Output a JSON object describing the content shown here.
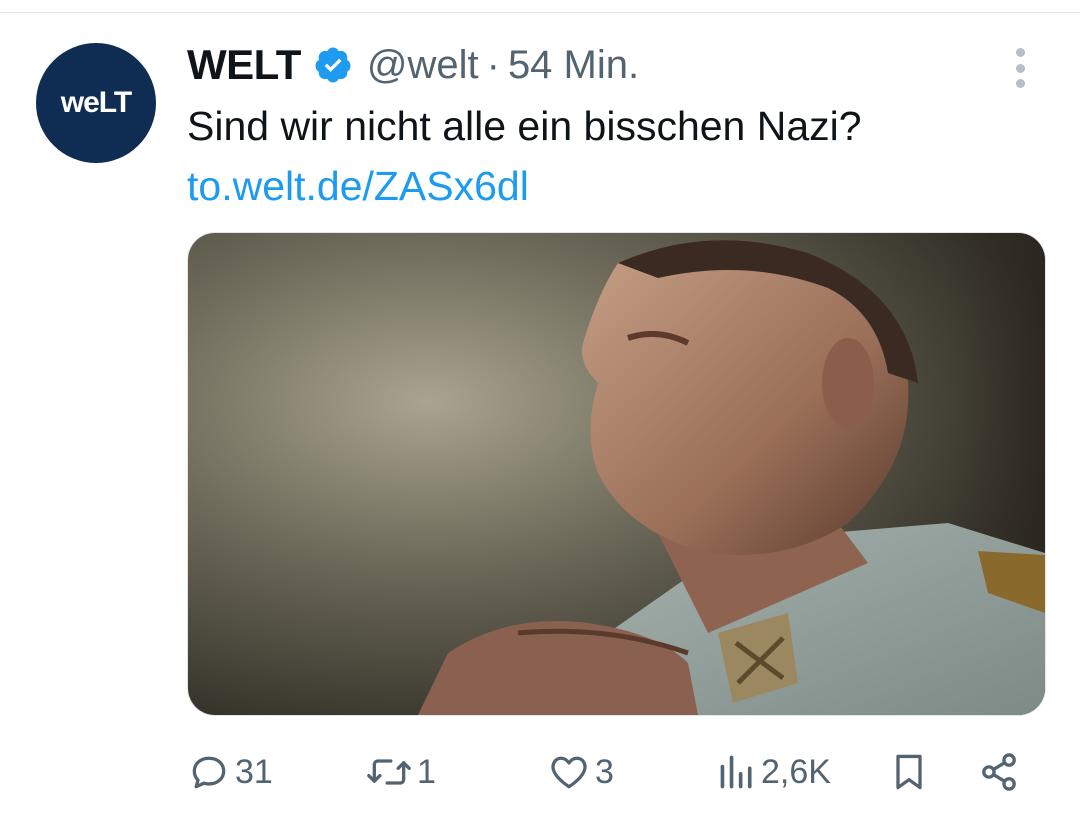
{
  "tweet": {
    "author_name": "WELT",
    "avatar_text": "weLT",
    "handle": "@welt",
    "separator": "·",
    "time": "54 Min.",
    "text": "Sind wir nicht alle ein bisschen Nazi?",
    "link": "to.welt.de/ZASx6dl",
    "verified": true
  },
  "actions": {
    "replies": "31",
    "retweets": "1",
    "likes": "3",
    "views": "2,6K"
  },
  "colors": {
    "avatar_bg": "#0f2d52",
    "link": "#1d9bf0",
    "verified": "#1d9bf0",
    "secondary_text": "#536471"
  },
  "icons": {
    "verified": "verified-badge-icon",
    "more": "more-vertical-icon",
    "reply": "reply-bubble-icon",
    "retweet": "retweet-icon",
    "like": "heart-icon",
    "views": "views-bar-chart-icon",
    "bookmark": "bookmark-icon",
    "share": "share-icon"
  }
}
